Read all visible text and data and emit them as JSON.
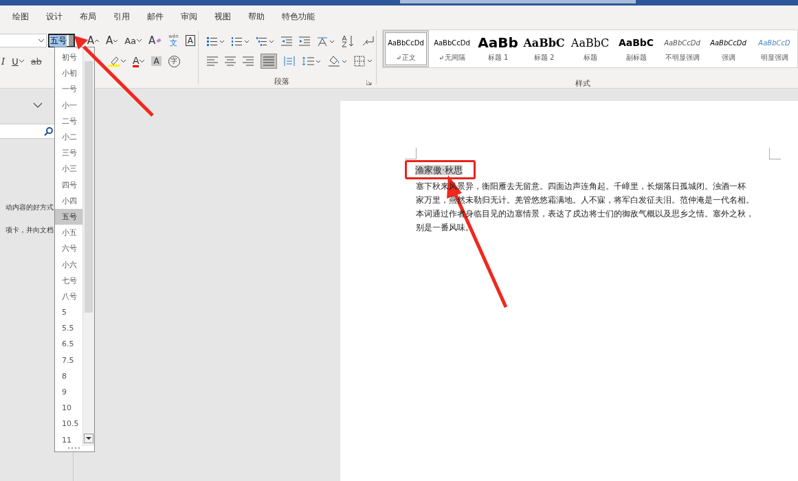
{
  "menu_tabs": [
    {
      "label": "绘图"
    },
    {
      "label": "设计"
    },
    {
      "label": "布局"
    },
    {
      "label": "引用"
    },
    {
      "label": "邮件"
    },
    {
      "label": "审阅"
    },
    {
      "label": "视图"
    },
    {
      "label": "帮助"
    },
    {
      "label": "特色功能"
    }
  ],
  "font_group": {
    "size": {
      "value": "五号",
      "highlighted": true
    },
    "row1": [
      {
        "kind": "grow",
        "text": "A"
      },
      {
        "kind": "shrink",
        "text": "A"
      },
      {
        "kind": "case",
        "text": "Aa"
      },
      {
        "kind": "clear",
        "text": "A"
      },
      {
        "kind": "phonetic",
        "text": "文",
        "ruby": "wén"
      },
      {
        "kind": "border",
        "text": "A"
      }
    ],
    "row2": [
      {
        "kind": "italic",
        "text": "I"
      },
      {
        "kind": "underline",
        "text": "U"
      },
      {
        "kind": "strike",
        "text": "ab"
      },
      {
        "kind": "highlight"
      },
      {
        "kind": "color",
        "text": "A"
      },
      {
        "kind": "shade",
        "text": "A"
      },
      {
        "kind": "enclose",
        "text": "字"
      }
    ]
  },
  "paragraph_group": {
    "label": "段落"
  },
  "styles_group": {
    "label": "样式",
    "styles": [
      {
        "preview": "AaBbCcDd",
        "name": "正文",
        "kind": "plain",
        "mark": true,
        "selected": true
      },
      {
        "preview": "AaBbCcDd",
        "name": "无间隔",
        "kind": "plain",
        "mark": true,
        "selected": false
      },
      {
        "preview": "AaBb",
        "name": "标题 1",
        "kind": "h1",
        "mark": false,
        "selected": false
      },
      {
        "preview": "AaBbC",
        "name": "标题 2",
        "kind": "h2",
        "mark": false,
        "selected": false
      },
      {
        "preview": "AaBbC",
        "name": "标题",
        "kind": "title",
        "mark": false,
        "selected": false
      },
      {
        "preview": "AaBbC",
        "name": "副标题",
        "kind": "subtitle",
        "mark": false,
        "selected": false
      },
      {
        "preview": "AaBbCcDd",
        "name": "不明显强调",
        "kind": "subtle",
        "mark": false,
        "selected": false
      },
      {
        "preview": "AaBbCcDd",
        "name": "强调",
        "kind": "emphasis",
        "mark": false,
        "selected": false
      },
      {
        "preview": "AaBbCcD",
        "name": "明显强调",
        "kind": "intense",
        "mark": false,
        "selected": false
      }
    ]
  },
  "nav_pane": {
    "lines": [
      "动内容的好方式",
      "项卡，并向文档"
    ]
  },
  "size_dropdown": {
    "items": [
      {
        "label": "初号",
        "selected": false
      },
      {
        "label": "小初",
        "selected": false
      },
      {
        "label": "一号",
        "selected": false
      },
      {
        "label": "小一",
        "selected": false
      },
      {
        "label": "二号",
        "selected": false
      },
      {
        "label": "小二",
        "selected": false
      },
      {
        "label": "三号",
        "selected": false
      },
      {
        "label": "小三",
        "selected": false
      },
      {
        "label": "四号",
        "selected": false
      },
      {
        "label": "小四",
        "selected": false
      },
      {
        "label": "五号",
        "selected": true
      },
      {
        "label": "小五",
        "selected": false
      },
      {
        "label": "六号",
        "selected": false
      },
      {
        "label": "小六",
        "selected": false
      },
      {
        "label": "七号",
        "selected": false
      },
      {
        "label": "八号",
        "selected": false
      },
      {
        "label": "5",
        "selected": false
      },
      {
        "label": "5.5",
        "selected": false
      },
      {
        "label": "6.5",
        "selected": false
      },
      {
        "label": "7.5",
        "selected": false
      },
      {
        "label": "8",
        "selected": false
      },
      {
        "label": "9",
        "selected": false
      },
      {
        "label": "10",
        "selected": false
      },
      {
        "label": "10.5",
        "selected": false
      },
      {
        "label": "11",
        "selected": false
      }
    ]
  },
  "document": {
    "title": {
      "text": "渔家傲·秋思",
      "selected": true
    },
    "body_lines": [
      "塞下秋来风景异，衡阳雁去无留意。四面边声连角起。千嶂里，长烟落日孤城闭。浊酒一杯",
      "家万里，燕然未勒归无计。羌管悠悠霜满地。人不寐，将军白发征夫泪。范仲淹是一代名相。",
      "本词通过作者身临目见的边塞情景，表达了戍边将士们的御敌气概以及思乡之情。塞外之秋，",
      "别是一番风味。"
    ]
  }
}
